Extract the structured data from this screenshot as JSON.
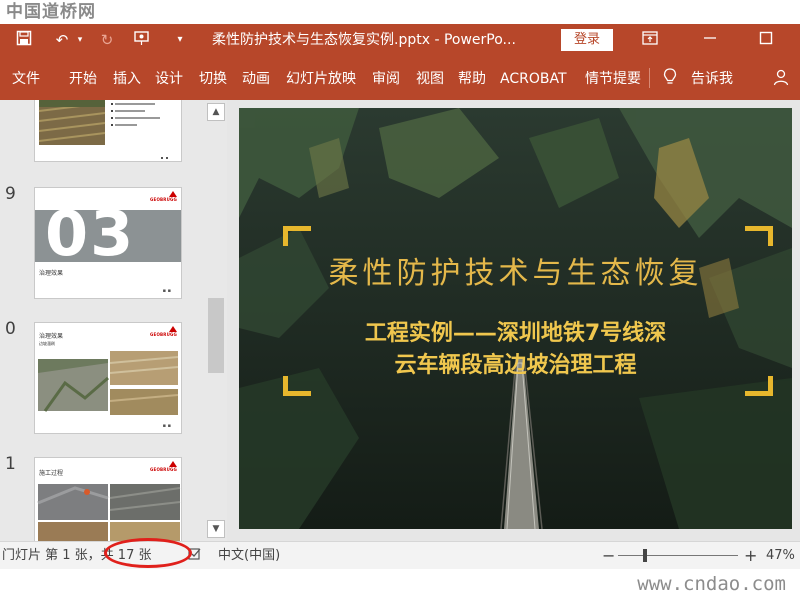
{
  "watermark": {
    "top": "中国道桥网",
    "bottom": "www.cndao.com"
  },
  "titlebar": {
    "title": "柔性防护技术与生态恢复实例.pptx  -  PowerPo...",
    "login_label": "登录"
  },
  "ribbon": {
    "tabs": [
      "文件",
      "开始",
      "插入",
      "设计",
      "切换",
      "动画",
      "幻灯片放映",
      "审阅",
      "视图",
      "帮助",
      "ACROBAT",
      "情节提要",
      "告诉我"
    ]
  },
  "thumbnails": {
    "numbers": [
      "9",
      "0",
      "1"
    ],
    "slide9": {
      "big": "03",
      "caption": "治理效果"
    },
    "slide10": {
      "title": "治理效果",
      "subtitle": "边坡溜刷"
    },
    "slide11": {
      "title": "施工过程"
    },
    "logo": "GEOBRUGG"
  },
  "slide": {
    "title": "柔性防护技术与生态恢复",
    "subtitle_line1": "工程实例——深圳地铁7号线深",
    "subtitle_line2": "云车辆段高边坡治理工程"
  },
  "status": {
    "slide_info": "门灯片 第 1 张，共 17 张",
    "language": "中文(中国)",
    "zoom_minus": "−",
    "zoom_plus": "+",
    "zoom_value": "47%"
  },
  "colors": {
    "accent": "#b7472a",
    "slide_text": "#e4b84a",
    "highlight": "#e0201b"
  }
}
